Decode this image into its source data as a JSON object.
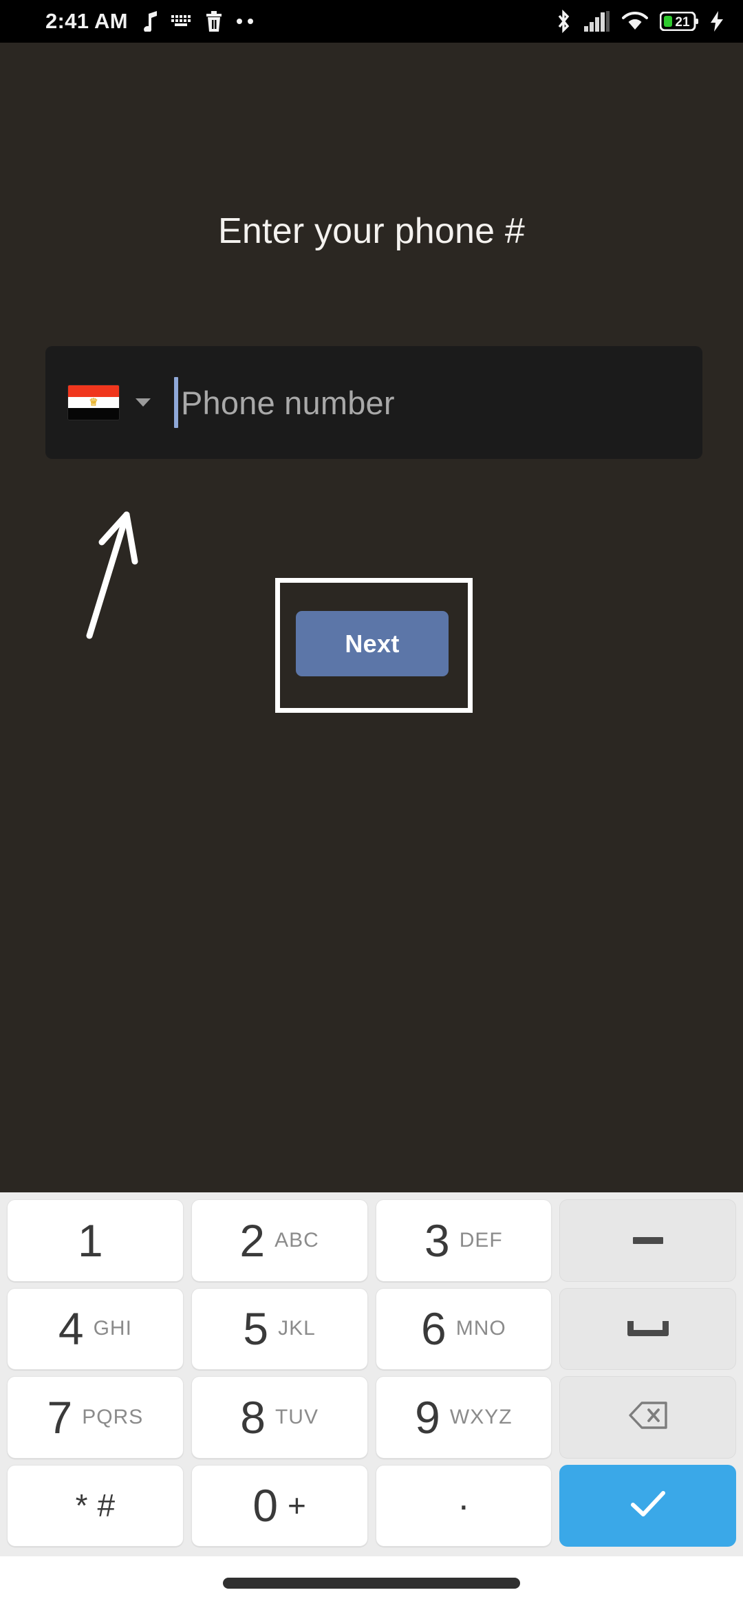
{
  "status_bar": {
    "time": "2:41 AM",
    "left_icons": [
      "music-note-icon",
      "keyboard-icon",
      "trash-icon",
      "more-dots-icon"
    ],
    "right_icons": [
      "bluetooth-icon",
      "cellular-signal-icon",
      "wifi-icon",
      "battery-icon",
      "charging-bolt-icon"
    ],
    "battery_level": "21",
    "battery_charging": true
  },
  "app": {
    "background_color": "#2b2722",
    "title": "Enter your phone #",
    "phone_field": {
      "country_flag": "egypt-flag",
      "flag_colors": [
        "#f0361d",
        "#fdfdfd",
        "#060606"
      ],
      "dropdown_icon": "chevron-down-icon",
      "value": "",
      "placeholder": "Phone number",
      "cursor_color": "#8fa8d8",
      "background_color": "#1b1b1b"
    },
    "annotation": {
      "arrow": "hand-drawn-arrow-pointing-to-phone-field",
      "box": "highlight-rectangle-around-next-button",
      "stroke_color": "#ffffff"
    },
    "next_button": {
      "label": "Next",
      "color": "#5c76a8",
      "text_color": "#ffffff"
    }
  },
  "keyboard": {
    "background_color": "#ececec",
    "accent_color": "#3aa8e8",
    "rows": [
      [
        {
          "digit": "1",
          "letters": "",
          "type": "digit"
        },
        {
          "digit": "2",
          "letters": "ABC",
          "type": "digit"
        },
        {
          "digit": "3",
          "letters": "DEF",
          "type": "digit"
        },
        {
          "digit": "",
          "letters": "",
          "type": "func",
          "icon": "dash-icon",
          "name": "dash-key"
        }
      ],
      [
        {
          "digit": "4",
          "letters": "GHI",
          "type": "digit"
        },
        {
          "digit": "5",
          "letters": "JKL",
          "type": "digit"
        },
        {
          "digit": "6",
          "letters": "MNO",
          "type": "digit"
        },
        {
          "digit": "",
          "letters": "",
          "type": "func",
          "icon": "space-icon",
          "name": "space-key"
        }
      ],
      [
        {
          "digit": "7",
          "letters": "PQRS",
          "type": "digit"
        },
        {
          "digit": "8",
          "letters": "TUV",
          "type": "digit"
        },
        {
          "digit": "9",
          "letters": "WXYZ",
          "type": "digit"
        },
        {
          "digit": "",
          "letters": "",
          "type": "func",
          "icon": "backspace-icon",
          "name": "backspace-key"
        }
      ],
      [
        {
          "digit": "*",
          "letters": "#",
          "type": "symbol",
          "name": "star-hash-key"
        },
        {
          "digit": "0",
          "letters": "+",
          "type": "symbol",
          "name": "zero-key"
        },
        {
          "digit": ".",
          "letters": "",
          "type": "dot",
          "name": "period-key"
        },
        {
          "digit": "",
          "letters": "",
          "type": "accent",
          "icon": "checkmark-icon",
          "name": "enter-key"
        }
      ]
    ]
  },
  "nav_bar": {
    "handle": "gesture-home-handle",
    "background_color": "#ffffff"
  }
}
